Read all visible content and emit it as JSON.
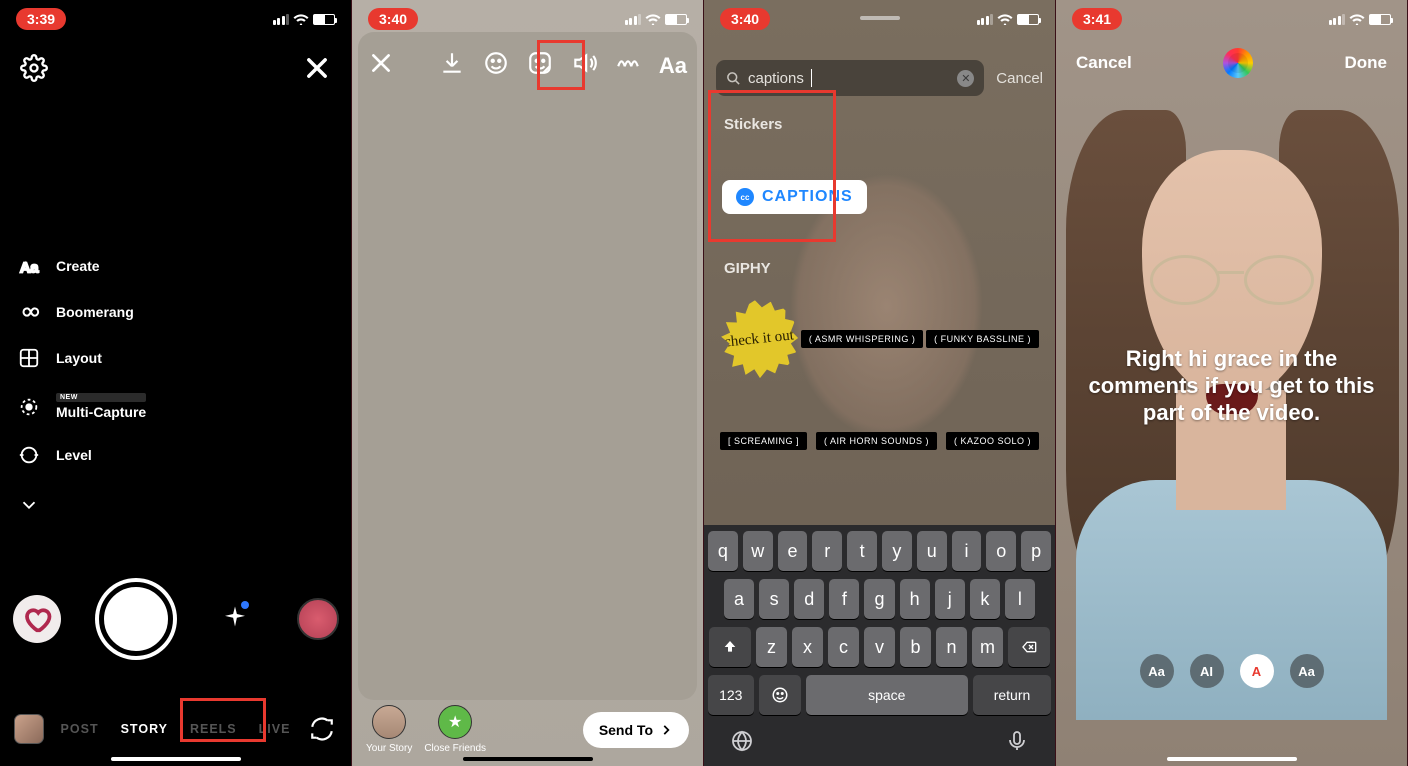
{
  "phone1": {
    "time": "3:39",
    "camera_options": [
      {
        "icon": "text",
        "label": "Create"
      },
      {
        "icon": "infinity",
        "label": "Boomerang"
      },
      {
        "icon": "layout",
        "label": "Layout"
      },
      {
        "icon": "multicapture",
        "label": "Multi-Capture",
        "badge": "NEW"
      },
      {
        "icon": "level",
        "label": "Level"
      }
    ],
    "modes": [
      "POST",
      "STORY",
      "REELS",
      "LIVE"
    ],
    "active_mode": "STORY"
  },
  "phone2": {
    "time": "3:40",
    "share": {
      "your_story": "Your Story",
      "close_friends": "Close Friends",
      "send_to": "Send To"
    }
  },
  "phone3": {
    "time": "3:40",
    "search": {
      "placeholder": "Search",
      "value": "captions"
    },
    "cancel": "Cancel",
    "section_stickers": "Stickers",
    "captions_sticker": "CAPTIONS",
    "section_giphy": "GIPHY",
    "giphy_row1": [
      "check it out",
      "( ASMR WHISPERING )",
      "( FUNKY BASSLINE )"
    ],
    "giphy_row2": [
      "[ SCREAMING ]",
      "( AIR HORN SOUNDS )",
      "( KAZOO SOLO )"
    ],
    "keyboard": {
      "r1": [
        "q",
        "w",
        "e",
        "r",
        "t",
        "y",
        "u",
        "i",
        "o",
        "p"
      ],
      "r2": [
        "a",
        "s",
        "d",
        "f",
        "g",
        "h",
        "j",
        "k",
        "l"
      ],
      "r3": [
        "z",
        "x",
        "c",
        "v",
        "b",
        "n",
        "m"
      ],
      "numbers": "123",
      "space": "space",
      "return": "return"
    }
  },
  "phone4": {
    "time": "3:41",
    "cancel": "Cancel",
    "done": "Done",
    "caption_text": "Right hi grace in the comments if you get to this part of the video.",
    "styles": [
      "Aa",
      "AI",
      "A",
      "Aa"
    ],
    "active_style_index": 2
  }
}
